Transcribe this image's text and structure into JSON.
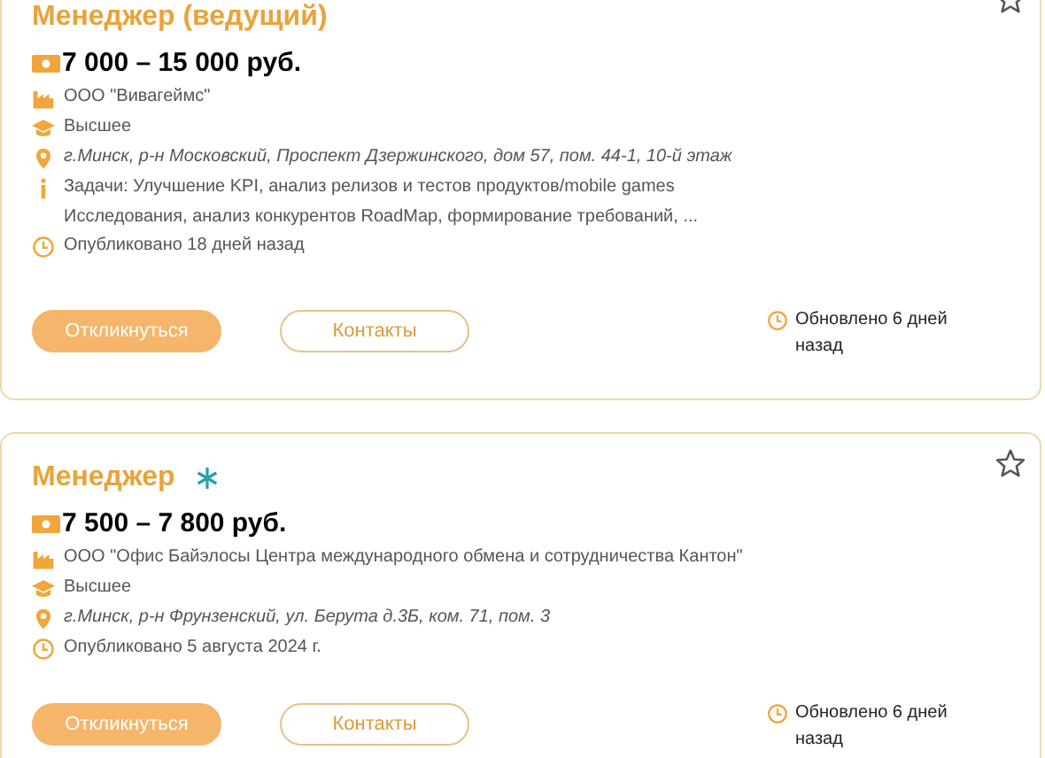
{
  "vacancies": [
    {
      "title": "Менеджер (ведущий)",
      "marked": false,
      "salary": "7 000 – 15 000 руб.",
      "details": [
        {
          "kind": "company",
          "lines": [
            "ООО \"Вивагеймс\""
          ]
        },
        {
          "kind": "education",
          "lines": [
            "Высшее"
          ]
        },
        {
          "kind": "address",
          "lines": [
            "г.Минск, р-н Московский, Проспект Дзержинского, дом 57, пом. 44-1, 10-й этаж"
          ]
        },
        {
          "kind": "tasks",
          "lines": [
            "Задачи: Улучшение KPI, анализ релизов и тестов продуктов/mobile games",
            "Исследования, анализ конкурентов RoadMap, формирование требований, ..."
          ]
        },
        {
          "kind": "published",
          "lines": [
            "Опубликовано 18 дней назад"
          ]
        }
      ],
      "buttons": [
        "Откликнуться",
        "Контакты"
      ],
      "updated": [
        "Обновлено 6 дней",
        "назад"
      ]
    },
    {
      "title": "Менеджер",
      "marked": true,
      "salary": "7 500 – 7 800 руб.",
      "details": [
        {
          "kind": "company",
          "lines": [
            "ООО \"Офис Байэлосы Центра международного обмена и сотрудничества Кантон\""
          ]
        },
        {
          "kind": "education",
          "lines": [
            "Высшее"
          ]
        },
        {
          "kind": "address",
          "lines": [
            "г.Минск, р-н Фрунзенский, ул. Берута д.3Б, ком. 71, пом. 3"
          ]
        },
        {
          "kind": "published",
          "lines": [
            "Опубликовано 5 августа 2024 г."
          ]
        }
      ],
      "buttons": [
        "Откликнуться",
        "Контакты"
      ],
      "updated": [
        "Обновлено 6 дней",
        "назад"
      ]
    }
  ]
}
